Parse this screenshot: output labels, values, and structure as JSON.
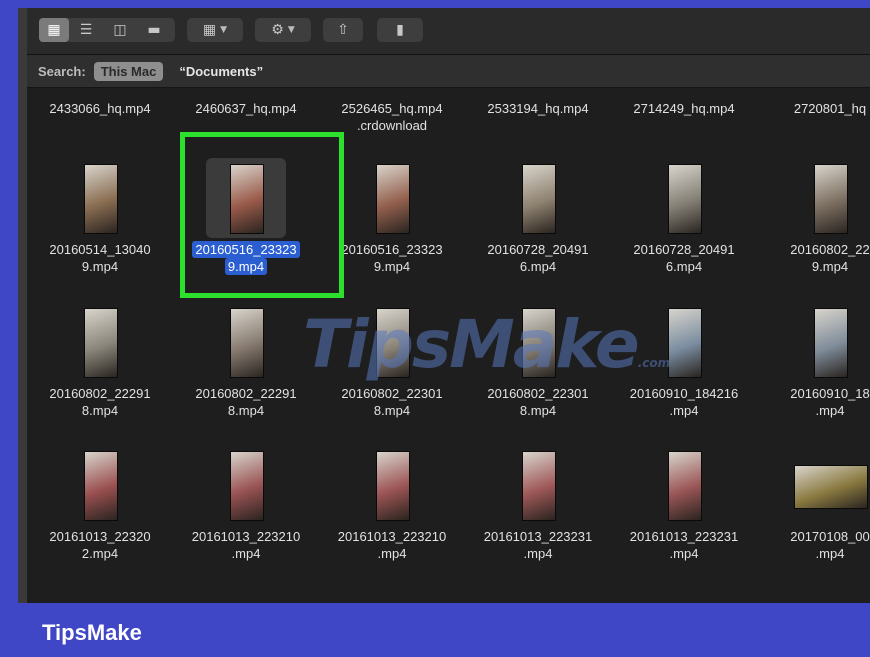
{
  "toolbar": {
    "view_icons": [
      "icon-view-icon",
      "list-view-icon",
      "column-view-icon",
      "gallery-view-icon"
    ],
    "group_icon": "group-grid-icon",
    "action_icon": "gear-icon",
    "share_icon": "share-icon",
    "tag_icon": "tag-icon"
  },
  "search": {
    "label": "Search:",
    "scope_active": "This Mac",
    "scope_folder": "“Documents”"
  },
  "files": [
    {
      "name1": "2433066_hq.mp4",
      "name2": "",
      "thumb": "",
      "selected": false
    },
    {
      "name1": "2460637_hq.mp4",
      "name2": "",
      "thumb": "",
      "selected": false
    },
    {
      "name1": "2526465_hq.mp4",
      "name2": ".crdownload",
      "thumb": "",
      "selected": false
    },
    {
      "name1": "2533194_hq.mp4",
      "name2": "",
      "thumb": "",
      "selected": false
    },
    {
      "name1": "2714249_hq.mp4",
      "name2": "",
      "thumb": "",
      "selected": false
    },
    {
      "name1": "2720801_hq",
      "name2": "",
      "thumb": "",
      "selected": false
    },
    {
      "name1": "20160514_13040",
      "name2": "9.mp4",
      "thumb": "#8a6e52",
      "selected": false
    },
    {
      "name1": "20160516_23323",
      "name2": "9.mp4",
      "thumb": "#9a5a4a",
      "selected": true
    },
    {
      "name1": "20160516_23323",
      "name2": "9.mp4",
      "thumb": "#94604e",
      "selected": false
    },
    {
      "name1": "20160728_20491",
      "name2": "6.mp4",
      "thumb": "#8e8270",
      "selected": false
    },
    {
      "name1": "20160728_20491",
      "name2": "6.mp4",
      "thumb": "#858076",
      "selected": false
    },
    {
      "name1": "20160802_22",
      "name2": "9.mp4",
      "thumb": "#7d7062",
      "selected": false
    },
    {
      "name1": "20160802_22291",
      "name2": "8.mp4",
      "thumb": "#8a857a",
      "selected": false
    },
    {
      "name1": "20160802_22291",
      "name2": "8.mp4",
      "thumb": "#85796e",
      "selected": false
    },
    {
      "name1": "20160802_22301",
      "name2": "8.mp4",
      "thumb": "#8b8479",
      "selected": false
    },
    {
      "name1": "20160802_22301",
      "name2": "8.mp4",
      "thumb": "#837d73",
      "selected": false
    },
    {
      "name1": "20160910_184216",
      "name2": ".mp4",
      "thumb": "#7b8da0",
      "selected": false
    },
    {
      "name1": "20160910_18",
      "name2": ".mp4",
      "thumb": "#7f8c9a",
      "selected": false
    },
    {
      "name1": "20161013_22320",
      "name2": "2.mp4",
      "thumb": "#9a5050",
      "selected": false
    },
    {
      "name1": "20161013_223210",
      "name2": ".mp4",
      "thumb": "#985252",
      "selected": false
    },
    {
      "name1": "20161013_223210",
      "name2": ".mp4",
      "thumb": "#9b5454",
      "selected": false
    },
    {
      "name1": "20161013_223231",
      "name2": ".mp4",
      "thumb": "#9e5858",
      "selected": false
    },
    {
      "name1": "20161013_223231",
      "name2": ".mp4",
      "thumb": "#9a5656",
      "selected": false
    },
    {
      "name1": "20170108_00",
      "name2": ".mp4",
      "thumb": "#8a7a40",
      "selected": false
    }
  ],
  "watermark": {
    "text": "TipsMake",
    "suffix": ".com"
  },
  "brand": "TipsMake"
}
